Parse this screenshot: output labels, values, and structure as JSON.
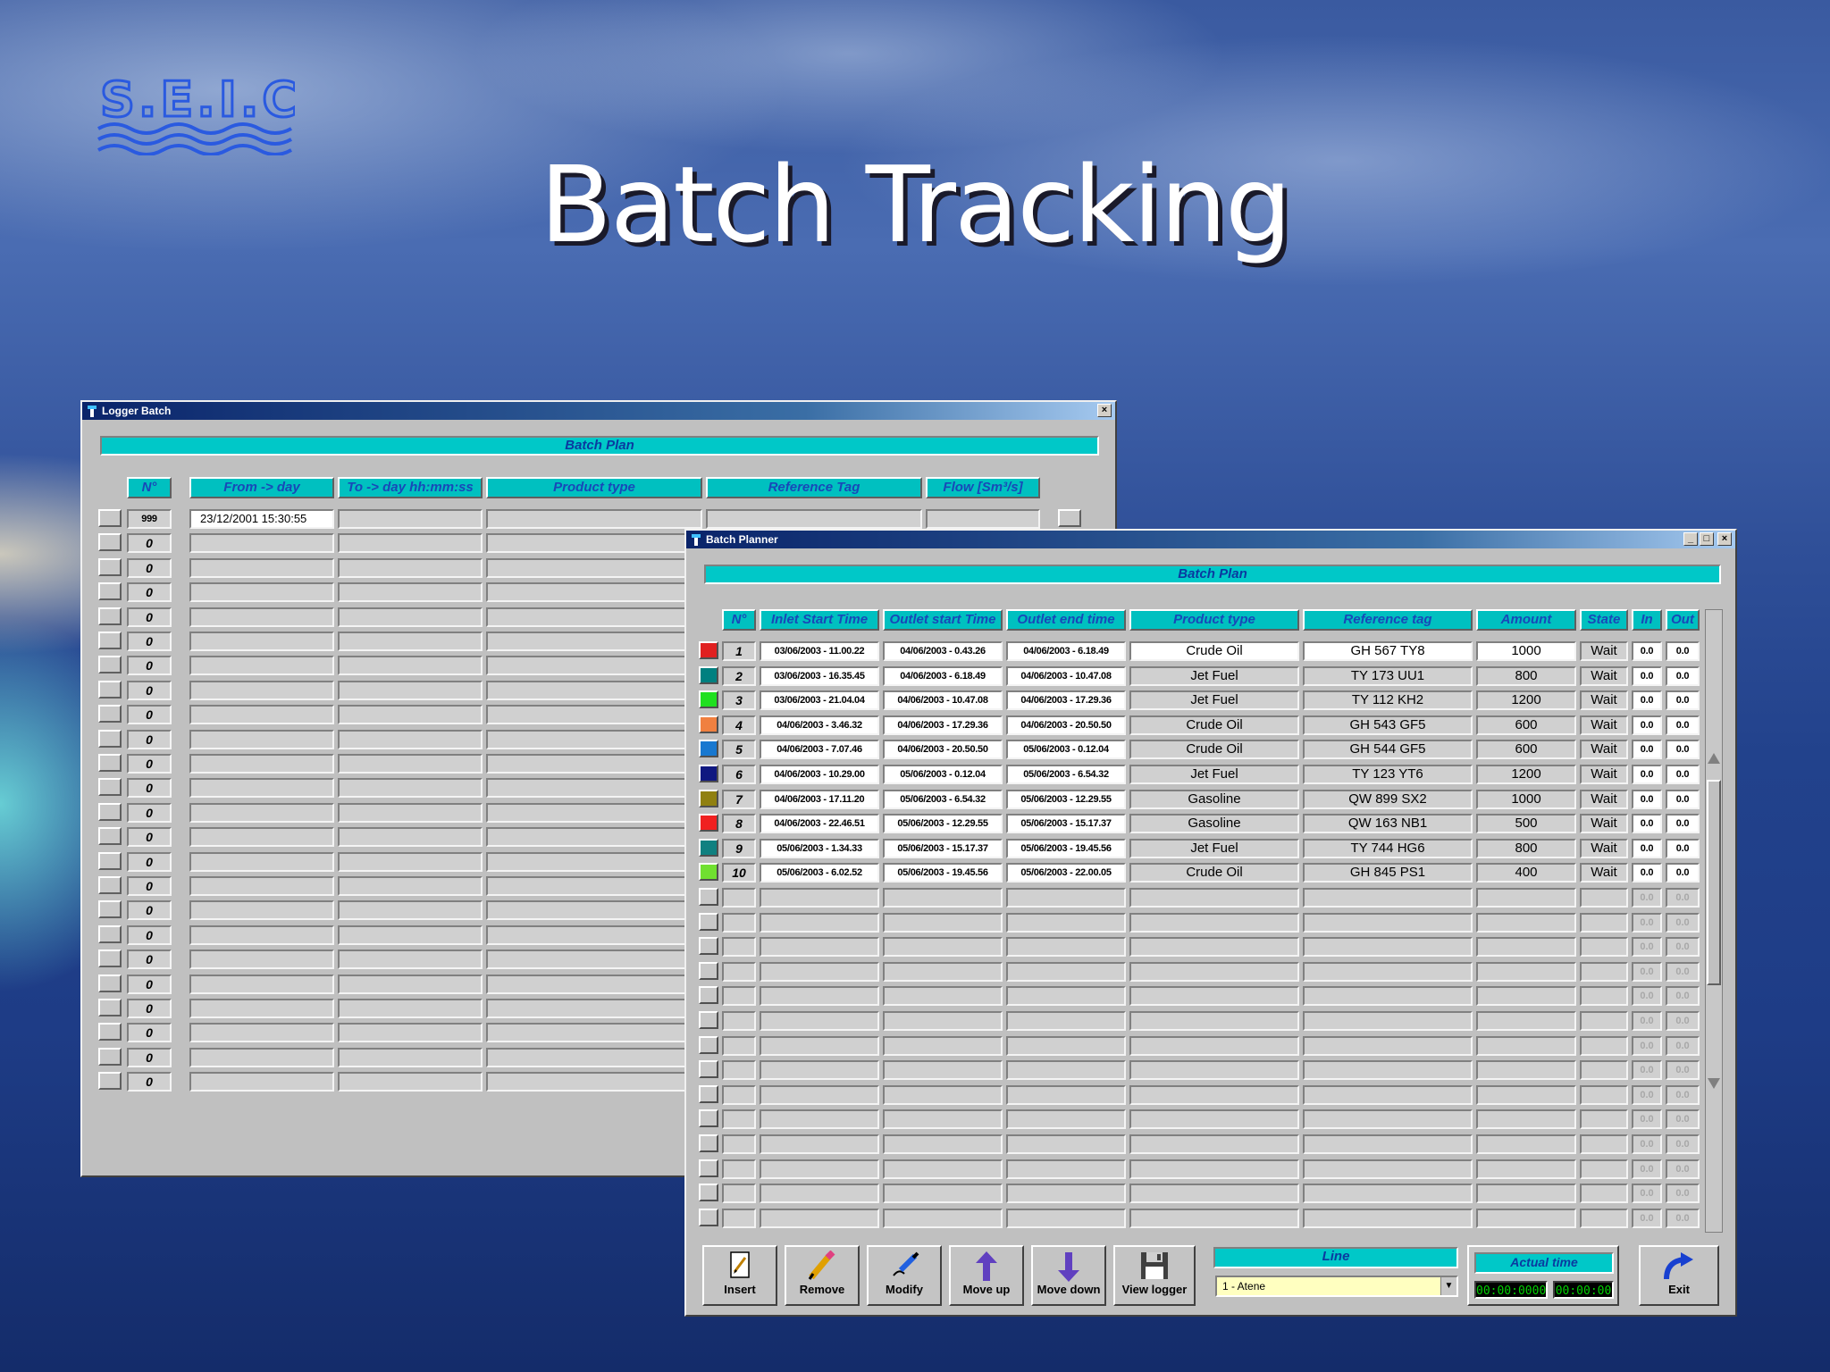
{
  "slide": {
    "title": "Batch Tracking",
    "logo_text": "S.E.I.C."
  },
  "logger": {
    "title": "Logger Batch",
    "banner": "Batch Plan",
    "headers": [
      "N°",
      "From -> day",
      "To -> day hh:mm:ss",
      "Product type",
      "Reference Tag",
      "Flow [Sm³/s]"
    ],
    "first_row": {
      "n": "999",
      "from": "23/12/2001 15:30:55"
    },
    "empty_row_n": "0",
    "empty_row_count": 23
  },
  "planner": {
    "title": "Batch Planner",
    "banner": "Batch Plan",
    "headers": [
      "N°",
      "Inlet Start Time",
      "Outlet start Time",
      "Outlet end time",
      "Product type",
      "Reference tag",
      "Amount",
      "State",
      "In",
      "Out"
    ],
    "rows": [
      {
        "n": "1",
        "color": "#e02020",
        "inlet": "03/06/2003 - 11.00.22",
        "out_start": "04/06/2003 - 0.43.26",
        "out_end": "04/06/2003 - 6.18.49",
        "product": "Crude Oil",
        "tag": "GH 567 TY8",
        "amount": "1000",
        "state": "Wait",
        "in": "0.0",
        "out": "0.0"
      },
      {
        "n": "2",
        "color": "#008080",
        "inlet": "03/06/2003 - 16.35.45",
        "out_start": "04/06/2003 - 6.18.49",
        "out_end": "04/06/2003 - 10.47.08",
        "product": "Jet Fuel",
        "tag": "TY 173 UU1",
        "amount": "800",
        "state": "Wait",
        "in": "0.0",
        "out": "0.0"
      },
      {
        "n": "3",
        "color": "#20e020",
        "inlet": "03/06/2003 - 21.04.04",
        "out_start": "04/06/2003 - 10.47.08",
        "out_end": "04/06/2003 - 17.29.36",
        "product": "Jet Fuel",
        "tag": "TY 112 KH2",
        "amount": "1200",
        "state": "Wait",
        "in": "0.0",
        "out": "0.0"
      },
      {
        "n": "4",
        "color": "#f08040",
        "inlet": "04/06/2003 - 3.46.32",
        "out_start": "04/06/2003 - 17.29.36",
        "out_end": "04/06/2003 - 20.50.50",
        "product": "Crude Oil",
        "tag": "GH 543 GF5",
        "amount": "600",
        "state": "Wait",
        "in": "0.0",
        "out": "0.0"
      },
      {
        "n": "5",
        "color": "#1878d0",
        "inlet": "04/06/2003 - 7.07.46",
        "out_start": "04/06/2003 - 20.50.50",
        "out_end": "05/06/2003 - 0.12.04",
        "product": "Crude Oil",
        "tag": "GH 544 GF5",
        "amount": "600",
        "state": "Wait",
        "in": "0.0",
        "out": "0.0"
      },
      {
        "n": "6",
        "color": "#101880",
        "inlet": "04/06/2003 - 10.29.00",
        "out_start": "05/06/2003 - 0.12.04",
        "out_end": "05/06/2003 - 6.54.32",
        "product": "Jet Fuel",
        "tag": "TY 123 YT6",
        "amount": "1200",
        "state": "Wait",
        "in": "0.0",
        "out": "0.0"
      },
      {
        "n": "7",
        "color": "#908010",
        "inlet": "04/06/2003 - 17.11.20",
        "out_start": "05/06/2003 - 6.54.32",
        "out_end": "05/06/2003 - 12.29.55",
        "product": "Gasoline",
        "tag": "QW 899 SX2",
        "amount": "1000",
        "state": "Wait",
        "in": "0.0",
        "out": "0.0"
      },
      {
        "n": "8",
        "color": "#f02020",
        "inlet": "04/06/2003 - 22.46.51",
        "out_start": "05/06/2003 - 12.29.55",
        "out_end": "05/06/2003 - 15.17.37",
        "product": "Gasoline",
        "tag": "QW 163 NB1",
        "amount": "500",
        "state": "Wait",
        "in": "0.0",
        "out": "0.0"
      },
      {
        "n": "9",
        "color": "#108080",
        "inlet": "05/06/2003 - 1.34.33",
        "out_start": "05/06/2003 - 15.17.37",
        "out_end": "05/06/2003 - 19.45.56",
        "product": "Jet Fuel",
        "tag": "TY 744 HG6",
        "amount": "800",
        "state": "Wait",
        "in": "0.0",
        "out": "0.0"
      },
      {
        "n": "10",
        "color": "#70e030",
        "inlet": "05/06/2003 - 6.02.52",
        "out_start": "05/06/2003 - 19.45.56",
        "out_end": "05/06/2003 - 22.00.05",
        "product": "Crude Oil",
        "tag": "GH 845 PS1",
        "amount": "400",
        "state": "Wait",
        "in": "0.0",
        "out": "0.0"
      }
    ],
    "empty_row_count": 14,
    "empty_in": "0.0",
    "empty_out": "0.0",
    "toolbar": [
      {
        "label": "Insert",
        "icon": "insert-icon"
      },
      {
        "label": "Remove",
        "icon": "remove-icon"
      },
      {
        "label": "Modify",
        "icon": "modify-icon"
      },
      {
        "label": "Move up",
        "icon": "move-up-icon"
      },
      {
        "label": "Move down",
        "icon": "move-down-icon"
      },
      {
        "label": "View logger",
        "icon": "save-icon"
      }
    ],
    "line_label": "Line",
    "line_value": "1 - Atene",
    "actual_time_label": "Actual time",
    "actual_time_1": "00:00:0000",
    "actual_time_2": "00:00:00",
    "exit_label": "Exit"
  }
}
